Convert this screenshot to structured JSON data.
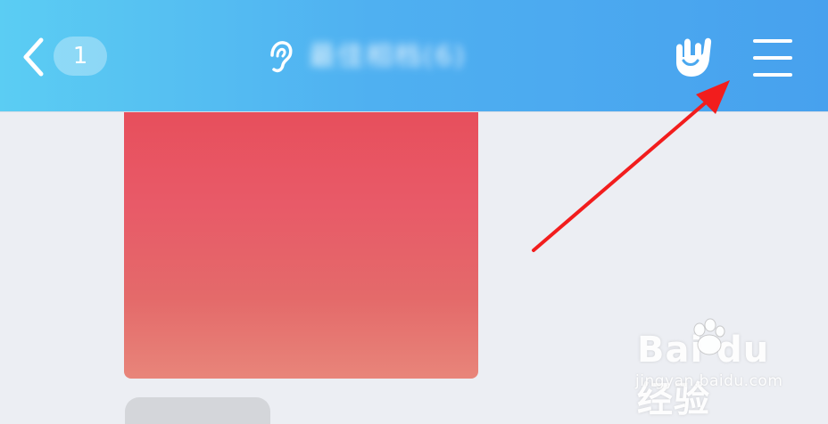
{
  "header": {
    "back_badge": "1",
    "title": "最佳相档(6)",
    "icons": [
      "back-icon",
      "ear-icon",
      "hand-gesture-icon",
      "menu-icon"
    ]
  },
  "chat": {
    "image_message_color_top": "#e74f5c",
    "image_message_color_bottom": "#e8857a"
  },
  "annotation": {
    "arrow_color": "#f21d1d",
    "points_to": "menu-icon"
  },
  "watermark": {
    "brand": "Bai du 经验",
    "url": "jingyan.baidu.com"
  }
}
